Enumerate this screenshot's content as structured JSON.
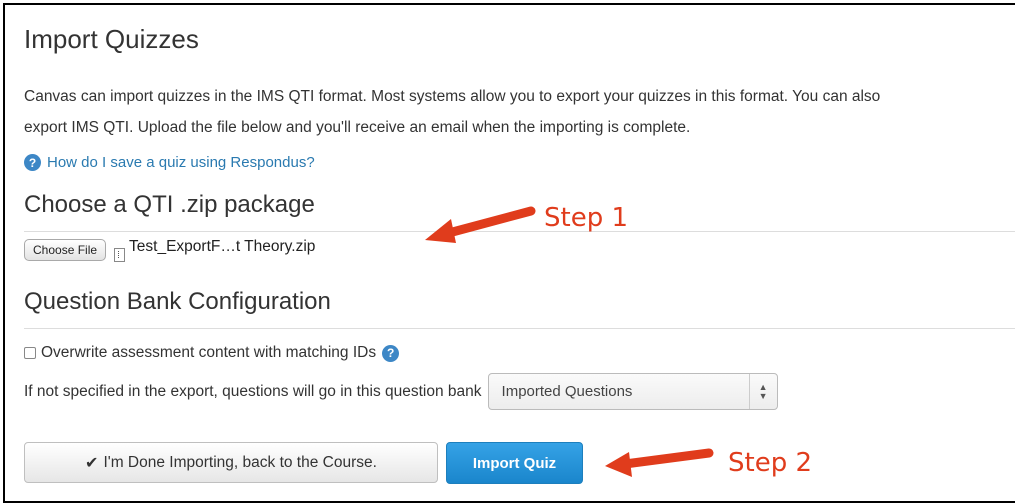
{
  "page": {
    "title": "Import Quizzes",
    "intro_lines": [
      "Canvas can import quizzes in the IMS QTI format. Most systems allow you to export your quizzes in this format. You can also",
      "export IMS QTI. Upload the file below and you'll receive an email when the importing is complete."
    ],
    "help_link": "How do I save a quiz using Respondus?"
  },
  "package": {
    "heading": "Choose a QTI .zip package",
    "choose_button": "Choose File",
    "file_name": "Test_ExportF…t Theory.zip"
  },
  "question_bank": {
    "heading": "Question Bank Configuration",
    "overwrite_label": "Overwrite assessment content with matching IDs",
    "overwrite_checked": false,
    "bank_label": "If not specified in the export, questions will go in this question bank",
    "bank_selected": "Imported Questions"
  },
  "actions": {
    "done_label": "I'm Done Importing, back to the Course.",
    "import_label": "Import Quiz"
  },
  "annotations": {
    "step1": "Step 1",
    "step2": "Step 2"
  },
  "colors": {
    "link": "#2a7ab0",
    "primary": "#1a86cc",
    "annotation": "#e03c1c"
  },
  "icons": [
    "help-icon",
    "file-icon",
    "checkmark-icon",
    "select-arrows-icon",
    "arrow-annotation-icon"
  ]
}
